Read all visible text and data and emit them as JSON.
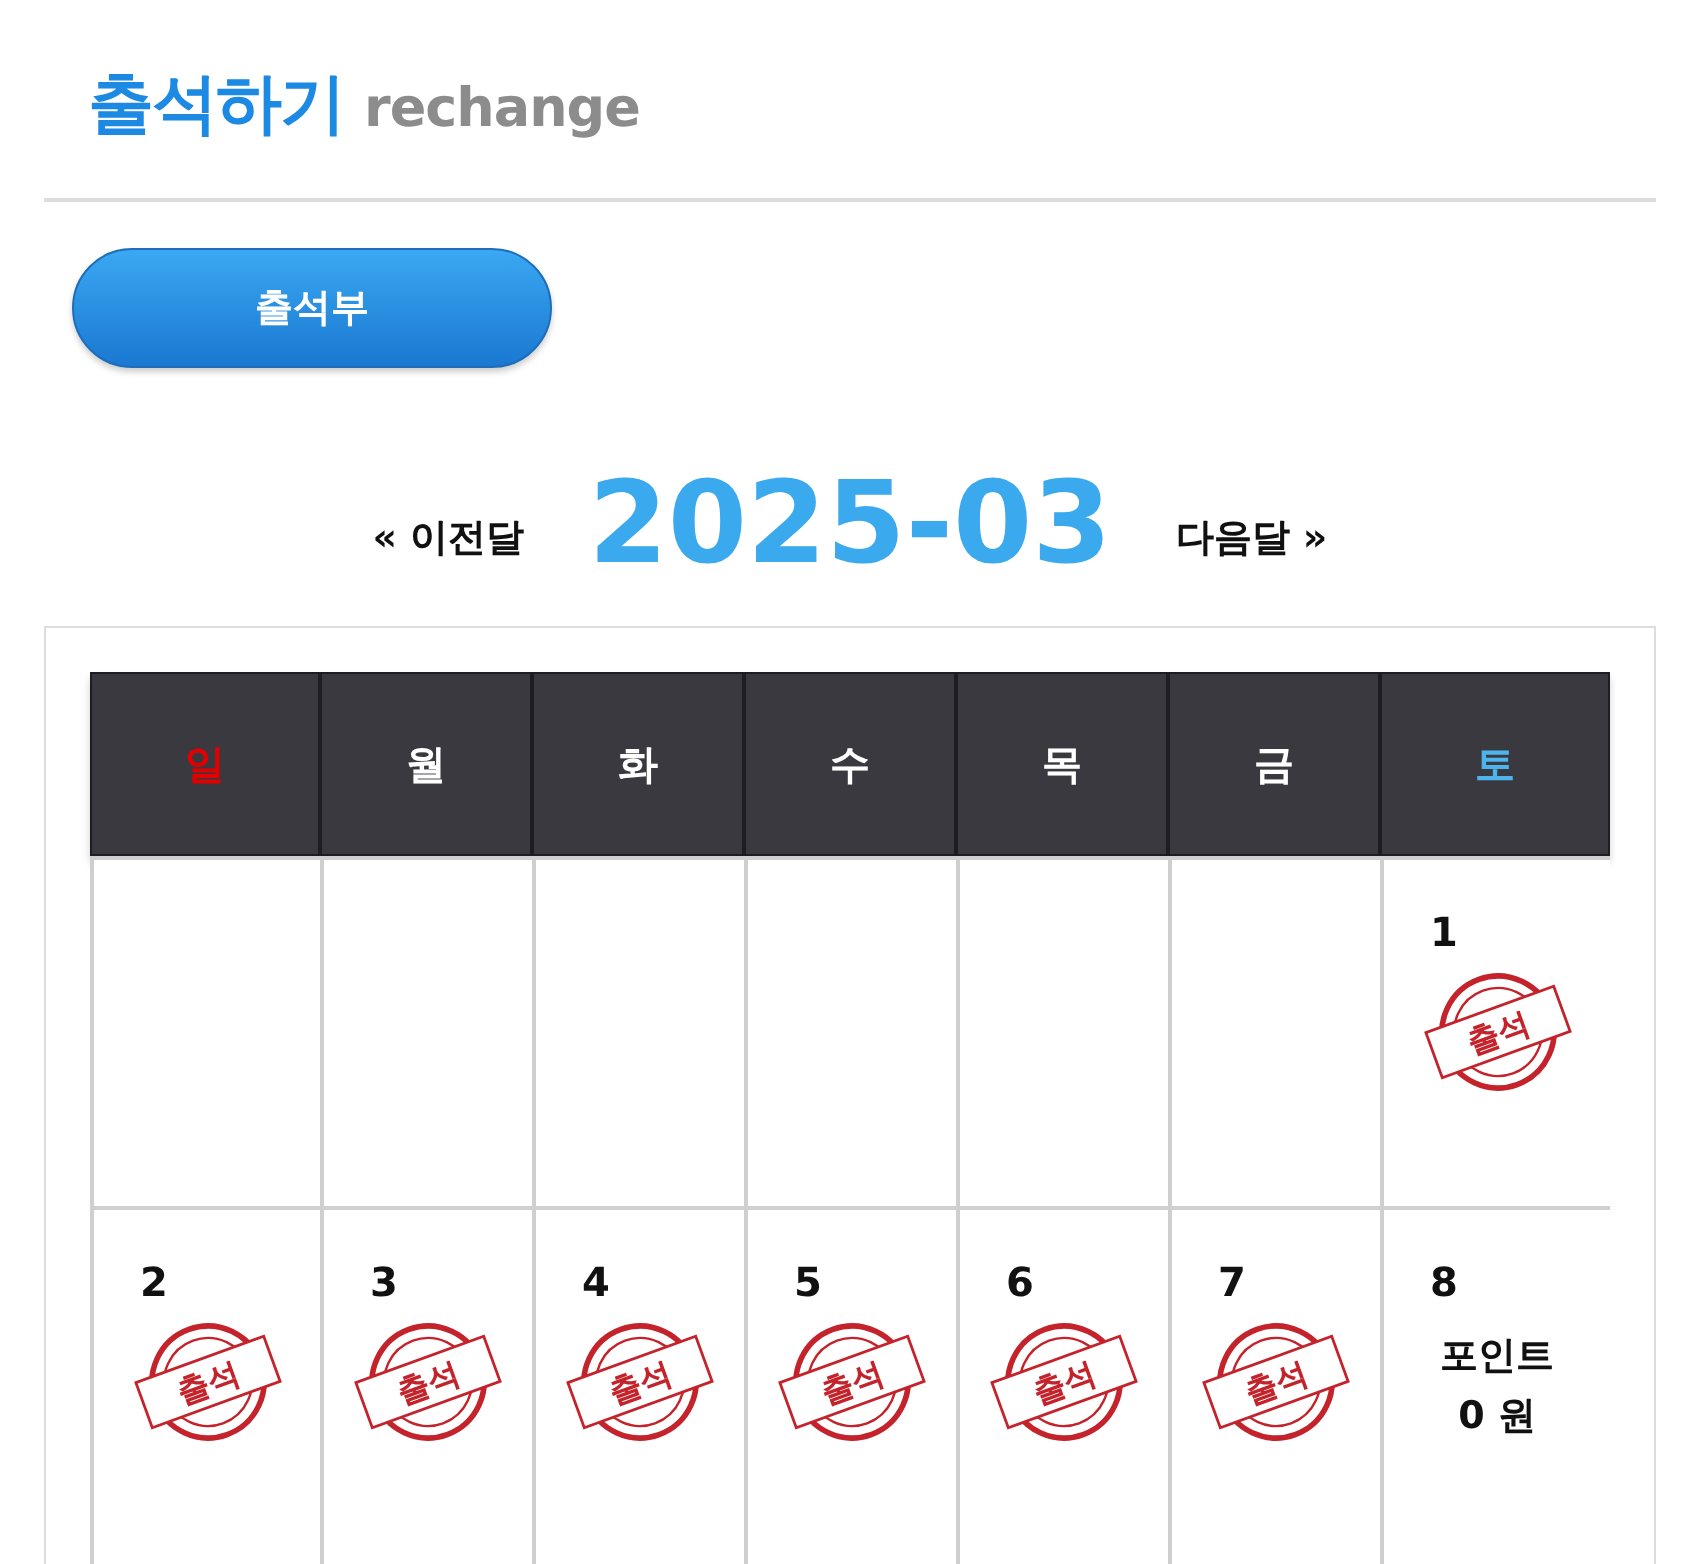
{
  "header": {
    "title": "출석하기",
    "subtitle": "rechange"
  },
  "attendance_button": {
    "label": "출석부"
  },
  "month_nav": {
    "prev": "« 이전달",
    "month": "2025-03",
    "next": "다음달 »"
  },
  "calendar": {
    "weekdays": [
      {
        "label": "일",
        "kind": "sunday"
      },
      {
        "label": "월",
        "kind": "weekday"
      },
      {
        "label": "화",
        "kind": "weekday"
      },
      {
        "label": "수",
        "kind": "weekday"
      },
      {
        "label": "목",
        "kind": "weekday"
      },
      {
        "label": "금",
        "kind": "weekday"
      },
      {
        "label": "토",
        "kind": "saturday"
      }
    ],
    "weeks": [
      [
        {
          "kind": "empty"
        },
        {
          "kind": "empty"
        },
        {
          "kind": "empty"
        },
        {
          "kind": "empty"
        },
        {
          "kind": "empty"
        },
        {
          "kind": "empty"
        },
        {
          "kind": "stamped",
          "day": "1",
          "stamp": "출석"
        }
      ],
      [
        {
          "kind": "stamped",
          "day": "2",
          "stamp": "출석"
        },
        {
          "kind": "stamped",
          "day": "3",
          "stamp": "출석"
        },
        {
          "kind": "stamped",
          "day": "4",
          "stamp": "출석"
        },
        {
          "kind": "stamped",
          "day": "5",
          "stamp": "출석"
        },
        {
          "kind": "stamped",
          "day": "6",
          "stamp": "출석"
        },
        {
          "kind": "stamped",
          "day": "7",
          "stamp": "출석"
        },
        {
          "kind": "points",
          "day": "8",
          "points_label": "포인트",
          "points": "0 원"
        }
      ]
    ]
  }
}
